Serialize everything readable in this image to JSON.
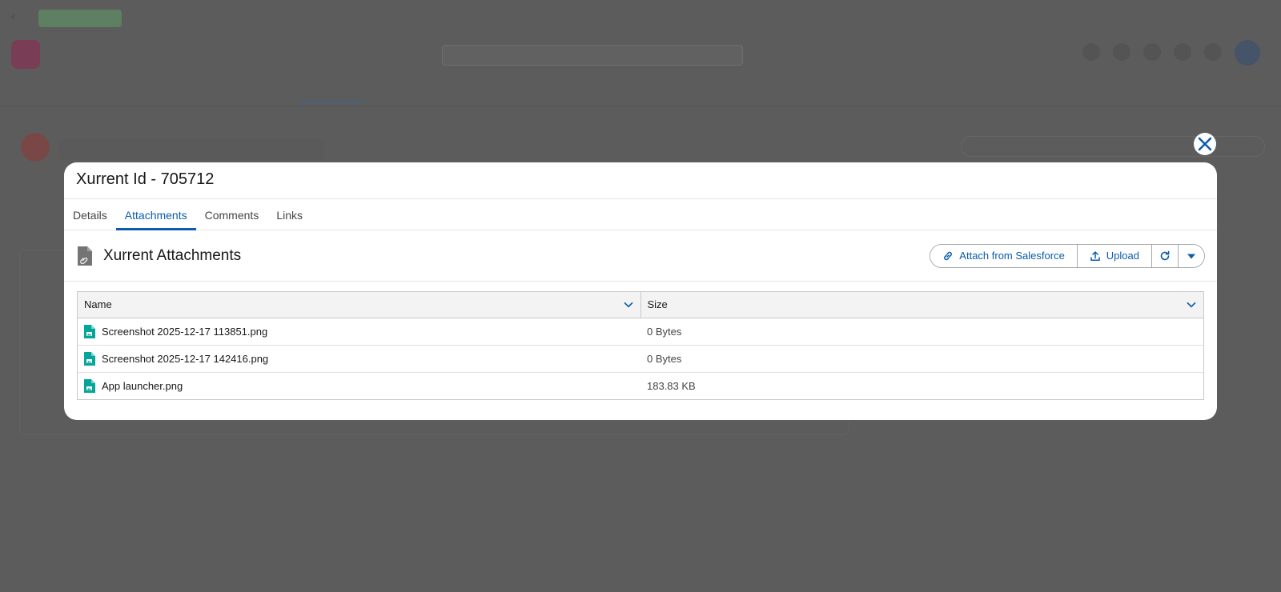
{
  "modal": {
    "title": "Xurrent Id - 705712",
    "close_label": "Close"
  },
  "tabs": [
    {
      "label": "Details",
      "active": false
    },
    {
      "label": "Attachments",
      "active": true
    },
    {
      "label": "Comments",
      "active": false
    },
    {
      "label": "Links",
      "active": false
    }
  ],
  "card": {
    "title": "Xurrent Attachments",
    "icon": "attachment-doc-icon",
    "actions": {
      "attach_label": "Attach from Salesforce",
      "upload_label": "Upload"
    }
  },
  "table": {
    "columns": [
      "Name",
      "Size"
    ],
    "rows": [
      {
        "name": "Screenshot 2025-12-17 113851.png",
        "size": "0 Bytes"
      },
      {
        "name": "Screenshot 2025-12-17 142416.png",
        "size": "0 Bytes"
      },
      {
        "name": "App launcher.png",
        "size": "183.83 KB"
      }
    ]
  },
  "colors": {
    "accent": "#0b5cab",
    "file_icon": "#06a59a",
    "overlay": "#5c5c5c"
  }
}
